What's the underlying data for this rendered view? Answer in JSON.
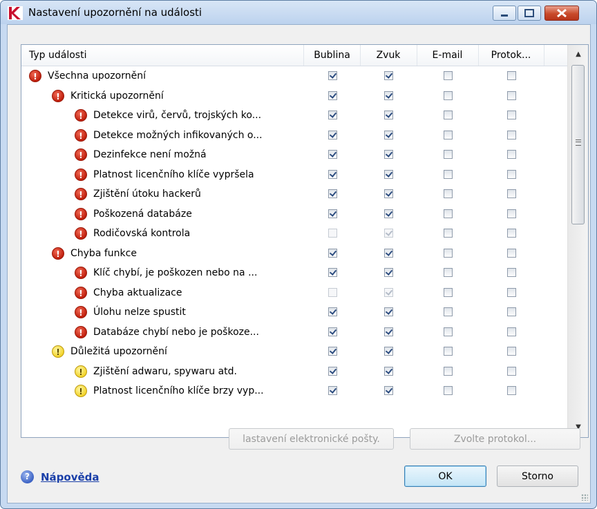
{
  "window": {
    "title": "Nastavení upozornění na události",
    "logo_letter": "K",
    "controls": [
      "minimize",
      "maximize",
      "close"
    ]
  },
  "table": {
    "columns": [
      "Typ události",
      "Bublina",
      "Zvuk",
      "E-mail",
      "Protok..."
    ],
    "rows": [
      {
        "label": "Všechna upozornění",
        "level": 0,
        "icon": "critical-icon",
        "bublina": true,
        "zvuk": true,
        "email": false,
        "protokol": false,
        "disabled": false
      },
      {
        "label": "Kritická upozornění",
        "level": 1,
        "icon": "critical-icon",
        "bublina": true,
        "zvuk": true,
        "email": false,
        "protokol": false,
        "disabled": false
      },
      {
        "label": "Detekce virů, červů, trojských ko...",
        "level": 2,
        "icon": "critical-icon",
        "bublina": true,
        "zvuk": true,
        "email": false,
        "protokol": false,
        "disabled": false
      },
      {
        "label": "Detekce možných infikovaných o...",
        "level": 2,
        "icon": "critical-icon",
        "bublina": true,
        "zvuk": true,
        "email": false,
        "protokol": false,
        "disabled": false
      },
      {
        "label": "Dezinfekce není možná",
        "level": 2,
        "icon": "critical-icon",
        "bublina": true,
        "zvuk": true,
        "email": false,
        "protokol": false,
        "disabled": false
      },
      {
        "label": "Platnost licenčního klíče vypršela",
        "level": 2,
        "icon": "critical-icon",
        "bublina": true,
        "zvuk": true,
        "email": false,
        "protokol": false,
        "disabled": false
      },
      {
        "label": "Zjištění útoku hackerů",
        "level": 2,
        "icon": "critical-icon",
        "bublina": true,
        "zvuk": true,
        "email": false,
        "protokol": false,
        "disabled": false
      },
      {
        "label": "Poškozená databáze",
        "level": 2,
        "icon": "critical-icon",
        "bublina": true,
        "zvuk": true,
        "email": false,
        "protokol": false,
        "disabled": false
      },
      {
        "label": "Rodičovská kontrola",
        "level": 2,
        "icon": "critical-icon",
        "bublina": false,
        "zvuk": true,
        "email": false,
        "protokol": false,
        "disabled": true
      },
      {
        "label": "Chyba funkce",
        "level": 1,
        "icon": "critical-icon",
        "bublina": true,
        "zvuk": true,
        "email": false,
        "protokol": false,
        "disabled": false
      },
      {
        "label": "Klíč chybí, je poškozen nebo na ...",
        "level": 2,
        "icon": "critical-icon",
        "bublina": true,
        "zvuk": true,
        "email": false,
        "protokol": false,
        "disabled": false
      },
      {
        "label": "Chyba aktualizace",
        "level": 2,
        "icon": "critical-icon",
        "bublina": false,
        "zvuk": true,
        "email": false,
        "protokol": false,
        "disabled": true
      },
      {
        "label": "Úlohu nelze spustit",
        "level": 2,
        "icon": "critical-icon",
        "bublina": true,
        "zvuk": true,
        "email": false,
        "protokol": false,
        "disabled": false
      },
      {
        "label": "Databáze chybí nebo je poškoze...",
        "level": 2,
        "icon": "critical-icon",
        "bublina": true,
        "zvuk": true,
        "email": false,
        "protokol": false,
        "disabled": false
      },
      {
        "label": "Důležitá upozornění",
        "level": 1,
        "icon": "warning-icon",
        "bublina": true,
        "zvuk": true,
        "email": false,
        "protokol": false,
        "disabled": false
      },
      {
        "label": "Zjištění adwaru, spywaru atd.",
        "level": 2,
        "icon": "warning-icon",
        "bublina": true,
        "zvuk": true,
        "email": false,
        "protokol": false,
        "disabled": false
      },
      {
        "label": "Platnost licenčního klíče brzy vyp...",
        "level": 2,
        "icon": "warning-icon",
        "bublina": true,
        "zvuk": true,
        "email": false,
        "protokol": false,
        "disabled": false
      }
    ]
  },
  "buttons": {
    "email_settings": "lastavení elektronické pošty.",
    "choose_log": "Zvolte protokol...",
    "ok": "OK",
    "cancel": "Storno"
  },
  "help": {
    "label": "Nápověda",
    "icon_glyph": "?"
  },
  "icon_glyphs": {
    "critical": "!",
    "warning": "!"
  },
  "colors": {
    "critical": "#c0200e",
    "warning": "#f2d32b",
    "link": "#1a3fa8",
    "title_bar": "#c7daf1"
  }
}
